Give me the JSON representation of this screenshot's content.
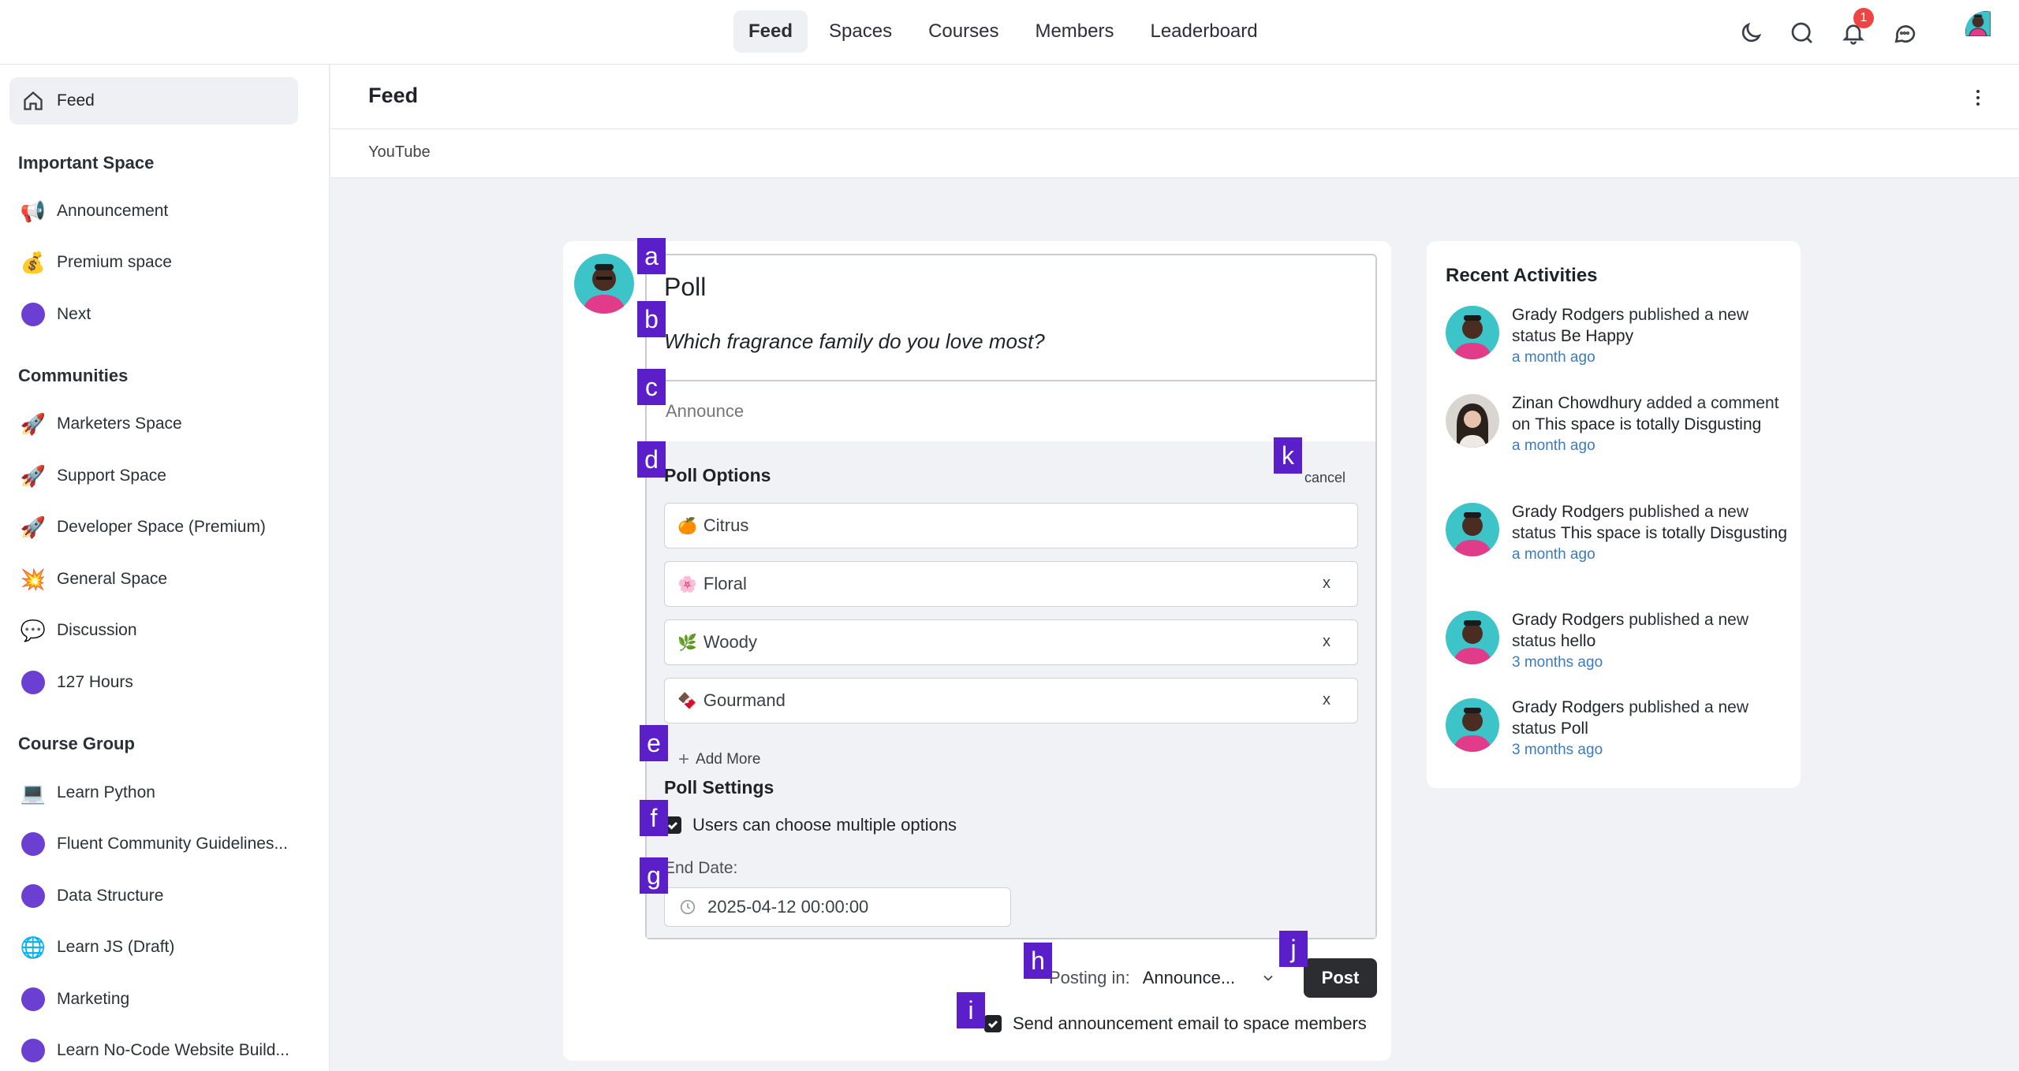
{
  "topnav": {
    "items": [
      {
        "label": "Feed",
        "active": true
      },
      {
        "label": "Spaces",
        "active": false
      },
      {
        "label": "Courses",
        "active": false
      },
      {
        "label": "Members",
        "active": false
      },
      {
        "label": "Leaderboard",
        "active": false
      }
    ],
    "icons": [
      "moon-icon",
      "search-icon",
      "bell-icon",
      "chat-icon"
    ],
    "notification_count": "1"
  },
  "sidebar": {
    "feed_label": "Feed",
    "sections": [
      {
        "heading": "Important Space",
        "items": [
          {
            "icon": "📢",
            "label": "Announcement"
          },
          {
            "icon": "💰",
            "label": "Premium space"
          },
          {
            "icon": "dot",
            "label": "Next"
          }
        ]
      },
      {
        "heading": "Communities",
        "items": [
          {
            "icon": "🚀",
            "label": "Marketers Space"
          },
          {
            "icon": "🚀",
            "label": "Support Space"
          },
          {
            "icon": "🚀",
            "label": "Developer Space (Premium)"
          },
          {
            "icon": "💥",
            "label": "General Space"
          },
          {
            "icon": "💬",
            "label": "Discussion"
          },
          {
            "icon": "dot",
            "label": "127 Hours"
          }
        ]
      },
      {
        "heading": "Course Group",
        "items": [
          {
            "icon": "💻",
            "label": "Learn Python"
          },
          {
            "icon": "dot",
            "label": "Fluent Community Guidelines..."
          },
          {
            "icon": "dot",
            "label": "Data Structure"
          },
          {
            "icon": "🌐",
            "label": "Learn JS (Draft)"
          },
          {
            "icon": "dot",
            "label": "Marketing"
          },
          {
            "icon": "dot",
            "label": "Learn No-Code Website Build..."
          }
        ]
      }
    ],
    "accent_color": "#6b3fd1"
  },
  "header": {
    "title": "Feed",
    "sub_tab": "YouTube"
  },
  "composer": {
    "title": "Poll",
    "question": "Which fragrance family do you love most?",
    "announce_placeholder": "Announce",
    "options_heading": "Poll Options",
    "cancel_label": "cancel",
    "options": [
      {
        "emoji": "🍊",
        "label": "Citrus",
        "removable": false
      },
      {
        "emoji": "🌸",
        "label": "Floral",
        "removable": true
      },
      {
        "emoji": "🌿",
        "label": "Woody",
        "removable": true
      },
      {
        "emoji": "🍫",
        "label": "Gourmand",
        "removable": true
      }
    ],
    "remove_label": "x",
    "add_more_label": "Add More",
    "settings_heading": "Poll Settings",
    "multiple_label": "Users can choose multiple options",
    "multiple_checked": true,
    "end_date_label": "End Date:",
    "end_date_value": "2025-04-12 00:00:00",
    "posting_label": "Posting in:",
    "posting_value": "Announce...",
    "post_button": "Post",
    "email_label": "Send announcement email to space members",
    "email_checked": true
  },
  "marks": [
    "a",
    "b",
    "c",
    "d",
    "e",
    "f",
    "g",
    "h",
    "i",
    "j",
    "k"
  ],
  "activities": {
    "heading": "Recent Activities",
    "items": [
      {
        "user": "Grady Rodgers",
        "action": " published a new status ",
        "target": "Be Happy",
        "time": "a month ago",
        "avatar": "man"
      },
      {
        "user": "Zinan Chowdhury",
        "action": " added a comment on ",
        "target": "This space is totally Disgusting",
        "time": "a month ago",
        "avatar": "woman"
      },
      {
        "user": "Grady Rodgers",
        "action": " published a new status ",
        "target": "This space is totally Disgusting",
        "time": "a month ago",
        "avatar": "man"
      },
      {
        "user": "Grady Rodgers",
        "action": " published a new status ",
        "target": "hello",
        "time": "3 months ago",
        "avatar": "man"
      },
      {
        "user": "Grady Rodgers",
        "action": " published a new status ",
        "target": "Poll",
        "time": "3 months ago",
        "avatar": "man"
      }
    ]
  }
}
